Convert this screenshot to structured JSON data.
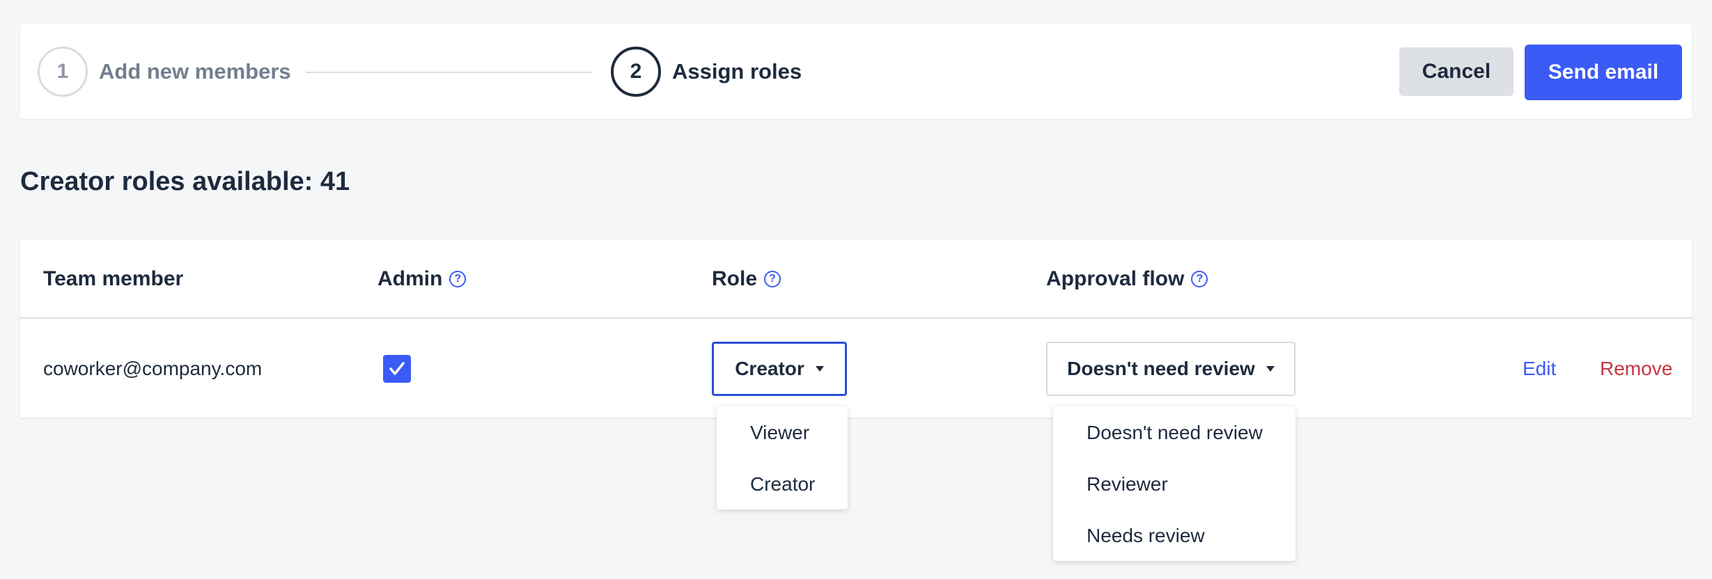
{
  "stepper": {
    "steps": [
      {
        "number": "1",
        "label": "Add new members"
      },
      {
        "number": "2",
        "label": "Assign roles"
      }
    ],
    "cancel_label": "Cancel",
    "send_label": "Send email"
  },
  "heading": "Creator roles available: 41",
  "table": {
    "columns": {
      "member": "Team member",
      "admin": "Admin",
      "role": "Role",
      "approval": "Approval flow"
    },
    "row": {
      "email": "coworker@company.com",
      "admin_checked": true,
      "role": "Creator",
      "approval": "Doesn't need review",
      "edit_label": "Edit",
      "remove_label": "Remove"
    }
  },
  "role_menu": {
    "options": [
      "Viewer",
      "Creator"
    ]
  },
  "approval_menu": {
    "options": [
      "Doesn't need review",
      "Reviewer",
      "Needs review"
    ]
  },
  "icons": {
    "help": "question-circle-icon",
    "check": "checkmark-icon",
    "caret": "caret-down-icon"
  },
  "colors": {
    "primary": "#3b5bf6",
    "danger": "#c7343f",
    "text": "#1e2a3d",
    "background": "#f5f6f8"
  }
}
